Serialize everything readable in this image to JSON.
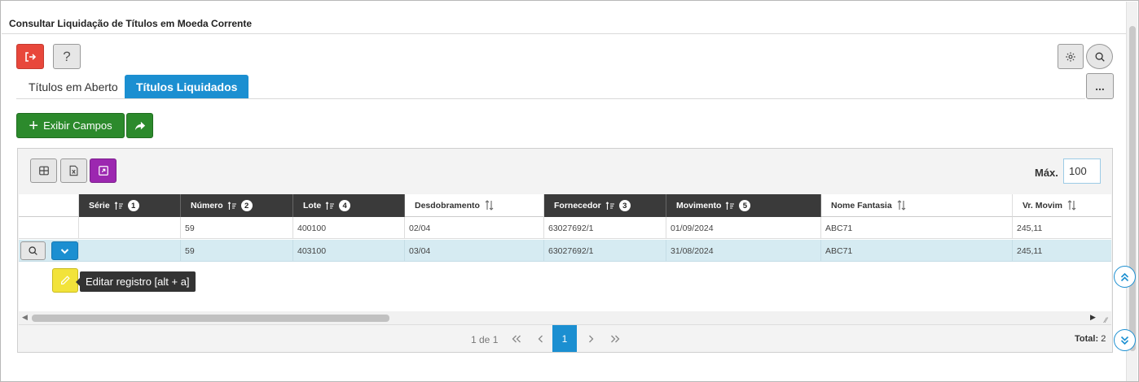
{
  "window": {
    "title": "Consultar Liquidação de Títulos em Moeda Corrente"
  },
  "toolbar": {
    "help_label": "?",
    "more_label": "..."
  },
  "tabs": [
    {
      "label": "Títulos em Aberto",
      "active": false
    },
    {
      "label": "Títulos Liquidados",
      "active": true
    }
  ],
  "actions": {
    "exibir_campos_label": "Exibir Campos"
  },
  "grid": {
    "max_label": "Máx.",
    "max_value": "100",
    "columns": [
      {
        "label": "",
        "style": "blank"
      },
      {
        "label": "Série",
        "sort_badge": "1"
      },
      {
        "label": "Número",
        "sort_badge": "2"
      },
      {
        "label": "Lote",
        "sort_badge": "4"
      },
      {
        "label": "Desdobramento",
        "sort_badge": ""
      },
      {
        "label": "Fornecedor",
        "sort_badge": "3"
      },
      {
        "label": "Movimento",
        "sort_badge": "5"
      },
      {
        "label": "Nome Fantasia",
        "sort_badge": ""
      },
      {
        "label": "Vr. Movim",
        "sort_badge": ""
      }
    ],
    "rows": [
      {
        "serie": "",
        "numero": "59",
        "lote": "400100",
        "desdobramento": "02/04",
        "fornecedor": "63027692/1",
        "movimento": "01/09/2024",
        "nome_fantasia": "ABC71",
        "vr_movim": "245,11",
        "selected": false
      },
      {
        "serie": "",
        "numero": "59",
        "lote": "403100",
        "desdobramento": "03/04",
        "fornecedor": "63027692/1",
        "movimento": "31/08/2024",
        "nome_fantasia": "ABC71",
        "vr_movim": "245,11",
        "selected": true
      }
    ],
    "edit_tooltip": "Editar registro [alt + a]"
  },
  "pager": {
    "info": "1 de 1",
    "current_page": "1",
    "total_label": "Total:",
    "total_value": "2"
  },
  "colors": {
    "primary": "#1b8fd1",
    "success": "#2c8a2c",
    "danger": "#e8473b",
    "purple": "#9c27b0",
    "edit": "#f2e33a",
    "header_dark": "#3a3a3a",
    "row_selected": "#d6ebf2"
  }
}
